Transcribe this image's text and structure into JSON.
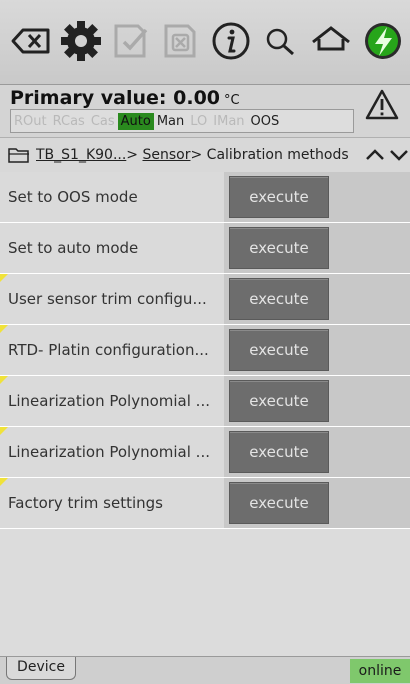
{
  "toolbar": {
    "icons": [
      "backspace-icon",
      "gear-icon",
      "checkmark-document-icon",
      "cancel-document-icon",
      "info-icon",
      "search-icon",
      "home-icon",
      "online-status-icon"
    ]
  },
  "status": {
    "primary_label": "Primary value: 0.00",
    "unit": "°C",
    "modes": [
      "ROut",
      "RCas",
      "Cas",
      "Auto",
      "Man",
      "LO",
      "IMan",
      "OOS"
    ],
    "active_mode": "Auto",
    "warning_icon": "warning-icon"
  },
  "breadcrumb": {
    "root": "TB_S1_K90...",
    "section": "Sensor",
    "page": "Calibration methods",
    "sep": ">"
  },
  "methods": [
    {
      "label": "Set to OOS mode",
      "button": "execute",
      "flag": false
    },
    {
      "label": "Set to auto mode",
      "button": "execute",
      "flag": false
    },
    {
      "label": "User sensor trim configu...",
      "button": "execute",
      "flag": true
    },
    {
      "label": "RTD- Platin configuration...",
      "button": "execute",
      "flag": true
    },
    {
      "label": "Linearization Polynomial ...",
      "button": "execute",
      "flag": true
    },
    {
      "label": "Linearization Polynomial ...",
      "button": "execute",
      "flag": true
    },
    {
      "label": "Factory trim settings",
      "button": "execute",
      "flag": true
    }
  ],
  "footer": {
    "tab": "Device",
    "connection": "online"
  },
  "colors": {
    "auto_mode": "#2a8a1e",
    "button": "#6d6d6d",
    "flag": "#f0e23a",
    "online": "#7fc86c",
    "status_icon": "#27a51a"
  }
}
